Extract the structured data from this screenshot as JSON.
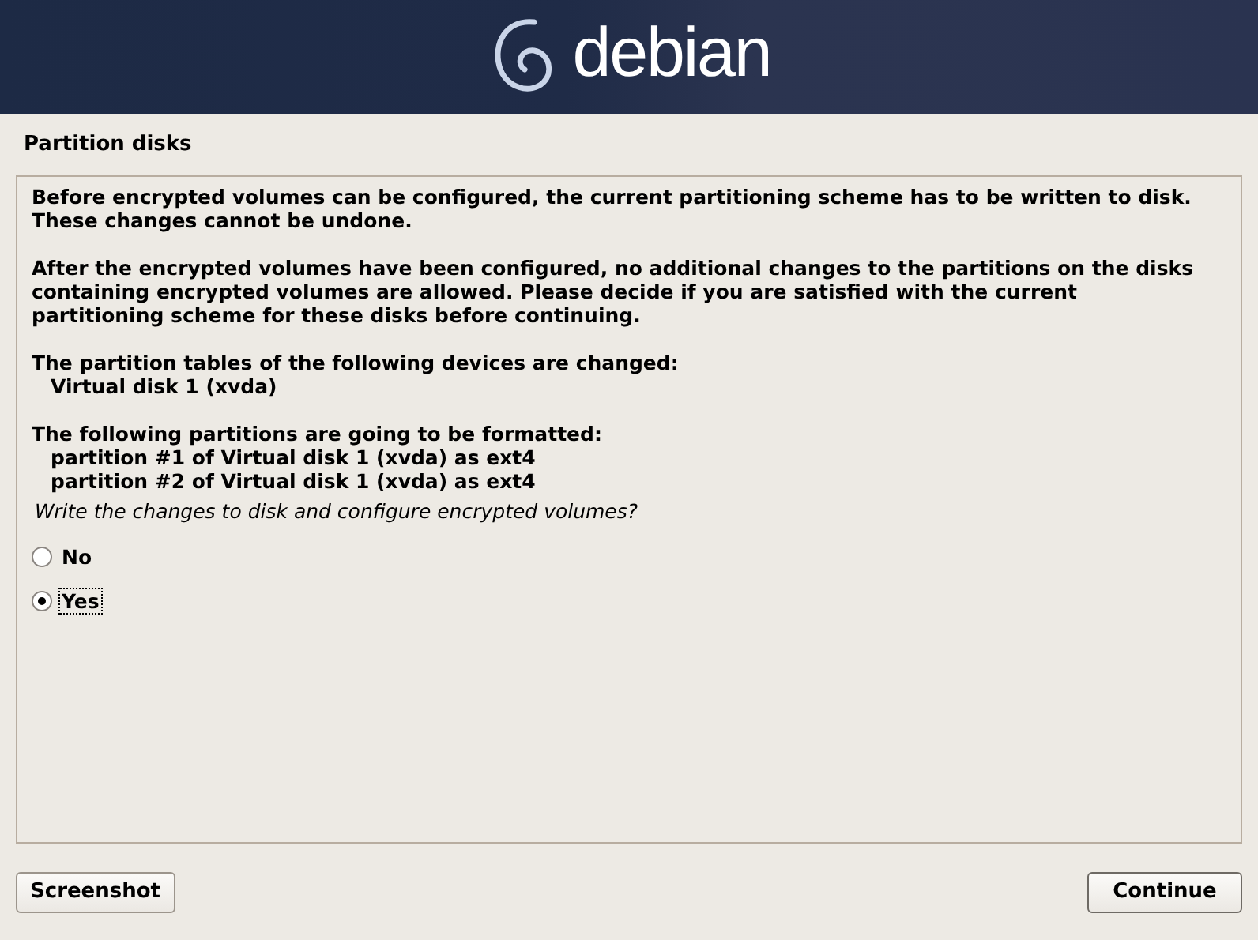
{
  "header": {
    "logo": "debian"
  },
  "title": "Partition disks",
  "sections": [
    {
      "kind": "paragraph",
      "lines": [
        "Before encrypted volumes can be configured, the current partitioning scheme has to be written to disk.",
        "These changes cannot be undone."
      ]
    },
    {
      "kind": "paragraph",
      "lines": [
        "After the encrypted volumes have been configured, no additional changes to the partitions on the disks",
        "containing encrypted volumes are allowed. Please decide if you are satisfied with the current",
        "partitioning scheme for these disks before continuing."
      ]
    },
    {
      "kind": "list",
      "heading": "The partition tables of the following devices are changed:",
      "items": [
        "Virtual disk 1 (xvda)"
      ]
    },
    {
      "kind": "list",
      "heading": "The following partitions are going to be formatted:",
      "items": [
        "partition #1 of Virtual disk 1 (xvda) as ext4",
        "partition #2 of Virtual disk 1 (xvda) as ext4"
      ]
    }
  ],
  "question": "Write the changes to disk and configure encrypted volumes?",
  "options": [
    {
      "label": "No",
      "selected": false
    },
    {
      "label": "Yes",
      "selected": true
    }
  ],
  "buttons": {
    "left": "Screenshot",
    "right": "Continue"
  }
}
